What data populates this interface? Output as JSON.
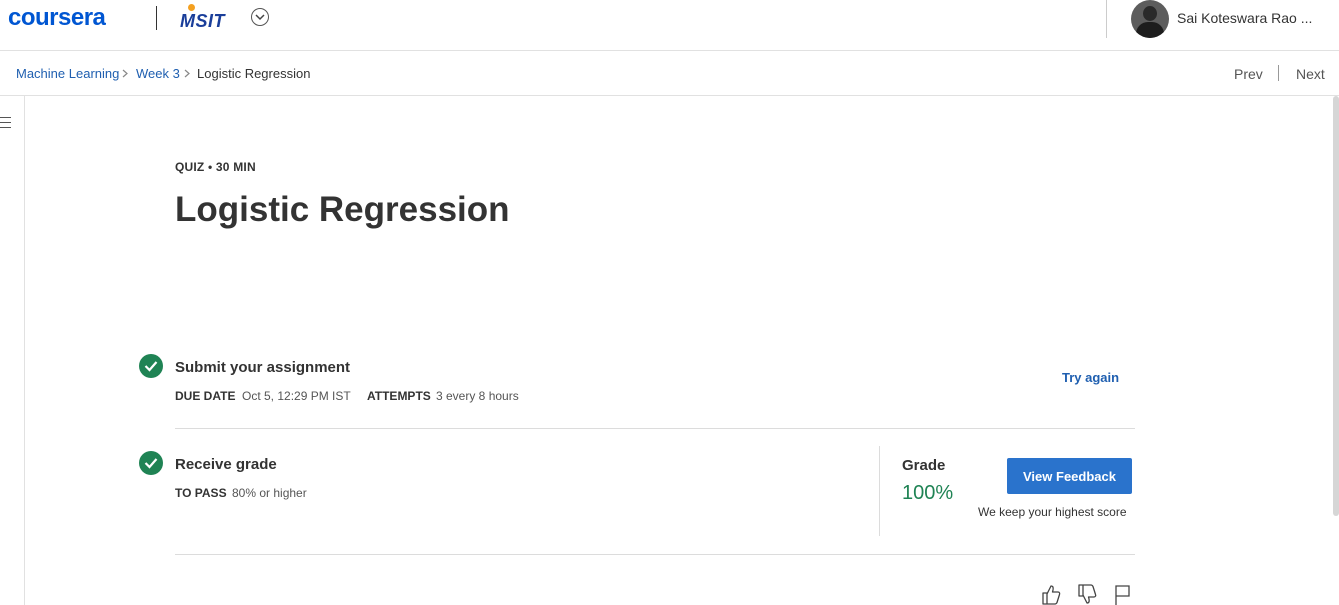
{
  "header": {
    "brand": "coursera",
    "partner": "MSIT",
    "user_name": "Sai Koteswara Rao ..."
  },
  "breadcrumb": {
    "items": [
      "Machine Learning",
      "Week 3",
      "Logistic Regression"
    ],
    "prev": "Prev",
    "next": "Next"
  },
  "quiz": {
    "meta": "QUIZ • 30 MIN",
    "title": "Logistic Regression"
  },
  "submit": {
    "title": "Submit your assignment",
    "due_label": "DUE DATE",
    "due_value": "Oct 5, 12:29 PM IST",
    "attempts_label": "ATTEMPTS",
    "attempts_value": "3 every 8 hours",
    "action": "Try again"
  },
  "receive": {
    "title": "Receive grade",
    "pass_label": "TO PASS",
    "pass_value": "80% or higher",
    "grade_label": "Grade",
    "grade_value": "100%",
    "button": "View Feedback",
    "note": "We keep your highest score"
  },
  "colors": {
    "brand_blue": "#0056d2",
    "link_blue": "#1f5fb0",
    "success_green": "#1f8354",
    "button_blue": "#2a73cc"
  },
  "icons": [
    "chevron-down-icon",
    "chevron-right-icon",
    "hamburger-icon",
    "check-circle-icon",
    "thumbs-up-icon",
    "thumbs-down-icon",
    "flag-icon"
  ]
}
